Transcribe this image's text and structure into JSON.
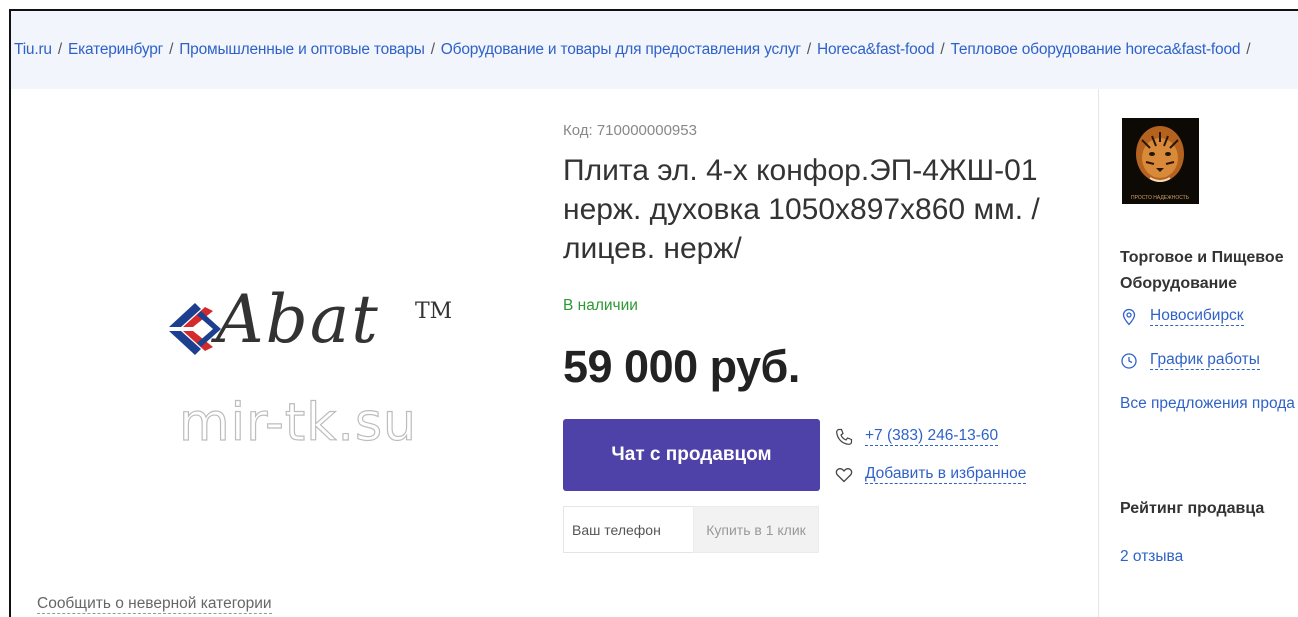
{
  "breadcrumb": [
    "Tiu.ru",
    "Екатеринбург",
    "Промышленные и оптовые товары",
    "Оборудование и товары для предоставления услуг",
    "Horeca&fast-food",
    "Тепловое оборудование horeca&fast-food"
  ],
  "breadcrumb_separator": "/",
  "product_image": {
    "logo_text": "Abat",
    "logo_tm": "TM",
    "watermark": "mir-tk.su"
  },
  "report_link": "Сообщить о неверной категории",
  "product": {
    "code": "Код: 710000000953",
    "title": "Плита эл. 4-х конфор.ЭП-4ЖШ-01 нерж. духовка 1050х897х860 мм. /лицев. нерж/",
    "availability": "В наличии",
    "price": "59 000 руб.",
    "chat_button": "Чат с продавцом",
    "phone": "+7 (383) 246-13-60",
    "favorite_link": "Добавить в избранное",
    "phone_placeholder": "Ваш телефон",
    "buy_one_click": "Купить в 1 клик"
  },
  "seller": {
    "name": "Торговое и Пищевое Оборудование",
    "avatar_caption": "ПРОСТО НАДЕЖНОСТЬ",
    "city": "Новосибирск",
    "schedule": "График работы",
    "all_offers": "Все предложения прода",
    "rating_title": "Рейтинг продавца",
    "reviews": "2 отзыва"
  },
  "colors": {
    "link": "#2f62c8",
    "in_stock": "#2b9a32",
    "chat_button": "#4e42a8",
    "breadcrumb_bg": "#f2f5fb"
  },
  "icons": {
    "phone": "phone-icon",
    "favorite": "heart-icon",
    "location": "location-pin-icon",
    "schedule": "clock-icon"
  }
}
